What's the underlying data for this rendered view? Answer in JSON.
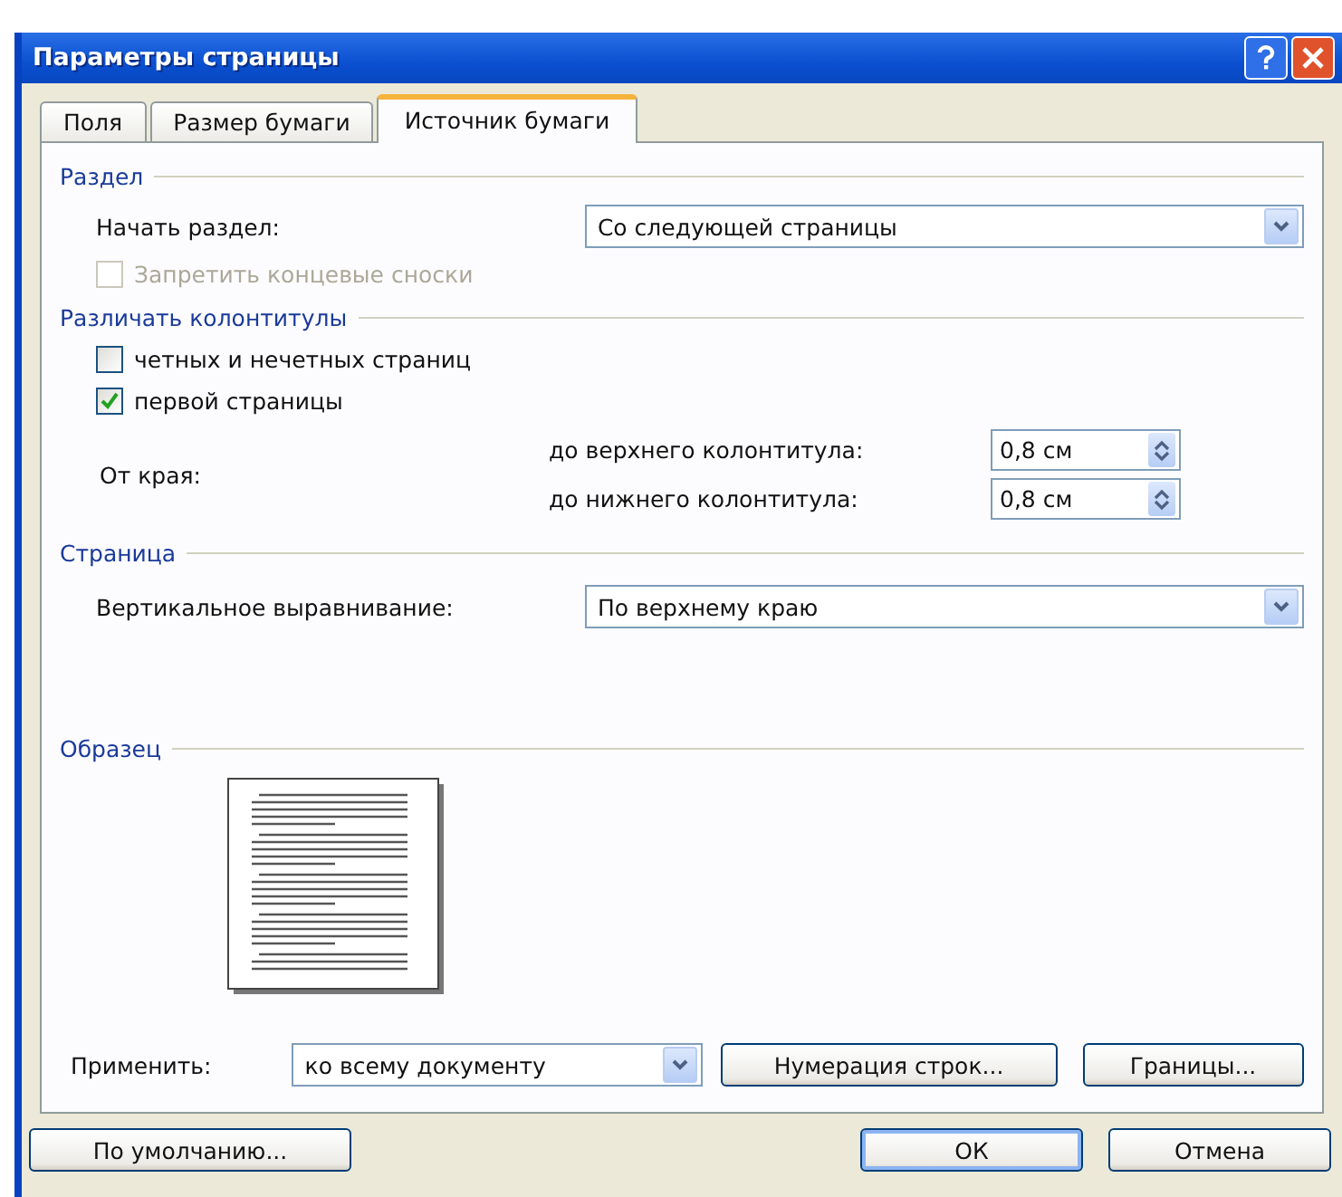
{
  "window": {
    "title": "Параметры страницы"
  },
  "tabs": [
    {
      "label": "Поля",
      "selected": false
    },
    {
      "label": "Размер бумаги",
      "selected": false
    },
    {
      "label": "Источник бумаги",
      "selected": true
    }
  ],
  "section": {
    "title": "Раздел",
    "start_label": "Начать раздел:",
    "start_value": "Со следующей страницы",
    "suppress_endnotes": {
      "label": "Запретить концевые сноски",
      "checked": false,
      "disabled": true
    }
  },
  "headers_footers": {
    "title": "Различать колонтитулы",
    "checkboxes": [
      {
        "label": "четных и нечетных страниц",
        "checked": false,
        "disabled": false
      },
      {
        "label": "первой страницы",
        "checked": true,
        "disabled": false
      }
    ],
    "from_edge_label": "От края:",
    "spinners": [
      {
        "label": "до верхнего колонтитула:",
        "value": "0,8 см"
      },
      {
        "label": "до нижнего колонтитула:",
        "value": "0,8 см"
      }
    ]
  },
  "page": {
    "title": "Страница",
    "valign_label": "Вертикальное выравнивание:",
    "valign_value": "По верхнему краю"
  },
  "preview": {
    "title": "Образец"
  },
  "apply": {
    "label": "Применить:",
    "value": "ко всему документу"
  },
  "panel_buttons": [
    "Нумерация строк...",
    "Границы..."
  ],
  "footer_buttons": [
    {
      "label": "По умолчанию...",
      "default": false
    },
    {
      "label": "ОК",
      "default": true
    },
    {
      "label": "Отмена",
      "default": false
    }
  ]
}
